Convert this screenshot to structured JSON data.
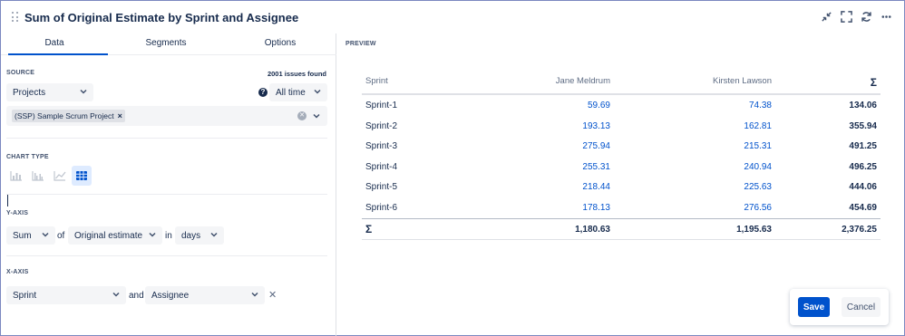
{
  "header": {
    "title": "Sum of Original Estimate by Sprint and Assignee",
    "icons": [
      "minimize-icon",
      "fullscreen-icon",
      "refresh-icon",
      "more-icon"
    ]
  },
  "tabs": [
    {
      "label": "Data",
      "active": true
    },
    {
      "label": "Segments",
      "active": false
    },
    {
      "label": "Options",
      "active": false
    }
  ],
  "source": {
    "label": "SOURCE",
    "issues_found": "2001 issues found",
    "type_select": "Projects",
    "time_select": "All time",
    "project_tag": "(SSP) Sample Scrum Project"
  },
  "chart_type": {
    "label": "CHART TYPE",
    "options": [
      "bar-chart-icon",
      "grouped-bar-chart-icon",
      "line-chart-icon",
      "table-icon"
    ],
    "selected": "table-icon"
  },
  "y_axis": {
    "label": "Y-AXIS",
    "aggregate": "Sum",
    "of_text": "of",
    "field": "Original estimate",
    "in_text": "in",
    "unit": "days"
  },
  "x_axis": {
    "label": "X-AXIS",
    "field": "Sprint",
    "and_text": "and",
    "group_by": "Assignee"
  },
  "preview": {
    "label": "PREVIEW",
    "columns": [
      "Sprint",
      "Jane Meldrum",
      "Kirsten Lawson",
      "Σ"
    ],
    "rows": [
      {
        "sprint": "Sprint-1",
        "jane": "59.69",
        "kirsten": "74.38",
        "total": "134.06"
      },
      {
        "sprint": "Sprint-2",
        "jane": "193.13",
        "kirsten": "162.81",
        "total": "355.94"
      },
      {
        "sprint": "Sprint-3",
        "jane": "275.94",
        "kirsten": "215.31",
        "total": "491.25"
      },
      {
        "sprint": "Sprint-4",
        "jane": "255.31",
        "kirsten": "240.94",
        "total": "496.25"
      },
      {
        "sprint": "Sprint-5",
        "jane": "218.44",
        "kirsten": "225.63",
        "total": "444.06"
      },
      {
        "sprint": "Sprint-6",
        "jane": "178.13",
        "kirsten": "276.56",
        "total": "454.69"
      }
    ],
    "totals": {
      "label": "Σ",
      "jane": "1,180.63",
      "kirsten": "1,195.63",
      "total": "2,376.25"
    }
  },
  "footer": {
    "save_label": "Save",
    "cancel_label": "Cancel"
  },
  "colors": {
    "accent": "#0052cc",
    "link_value": "#0052cc",
    "text": "#172b4d",
    "selected_chart_bg": "#deebff"
  }
}
